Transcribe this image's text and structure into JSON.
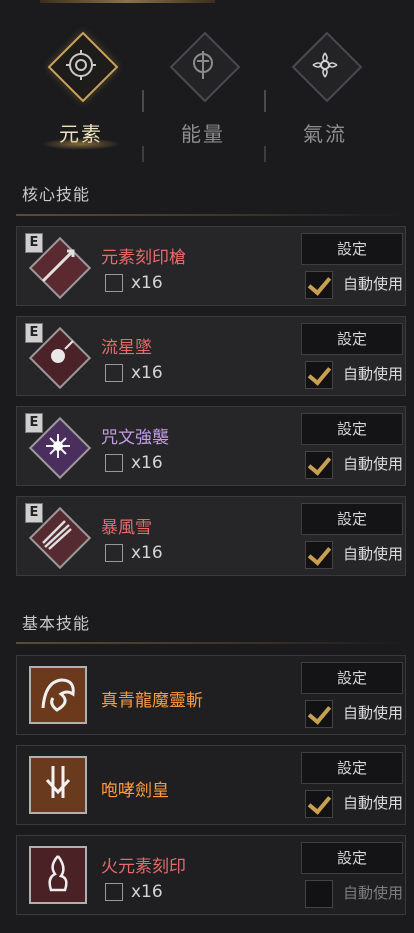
{
  "tabs": [
    {
      "label": "元素",
      "icon": "compass-icon",
      "active": true
    },
    {
      "label": "能量",
      "icon": "sword-icon",
      "active": false
    },
    {
      "label": "氣流",
      "icon": "flower-icon",
      "active": false
    }
  ],
  "sections": {
    "core": "核心技能",
    "basic": "基本技能"
  },
  "common": {
    "badge": "E",
    "set_label": "設定",
    "auto_label": "自動使用"
  },
  "core_skills": [
    {
      "name": "元素刻印槍",
      "count": "x16",
      "auto": true,
      "color": "#e86a6a"
    },
    {
      "name": "流星墜",
      "count": "x16",
      "auto": true,
      "color": "#e86a6a"
    },
    {
      "name": "咒文強襲",
      "count": "x16",
      "auto": true,
      "color": "#c49be8"
    },
    {
      "name": "暴風雪",
      "count": "x16",
      "auto": true,
      "color": "#e86a6a"
    }
  ],
  "basic_skills": [
    {
      "name": "真青龍魔靈斬",
      "auto": true,
      "color": "#ff9a3c"
    },
    {
      "name": "咆哮劍皇",
      "auto": true,
      "color": "#ff9a3c"
    },
    {
      "name": "火元素刻印",
      "count": "x16",
      "auto": false,
      "color": "#e86a6a"
    }
  ]
}
